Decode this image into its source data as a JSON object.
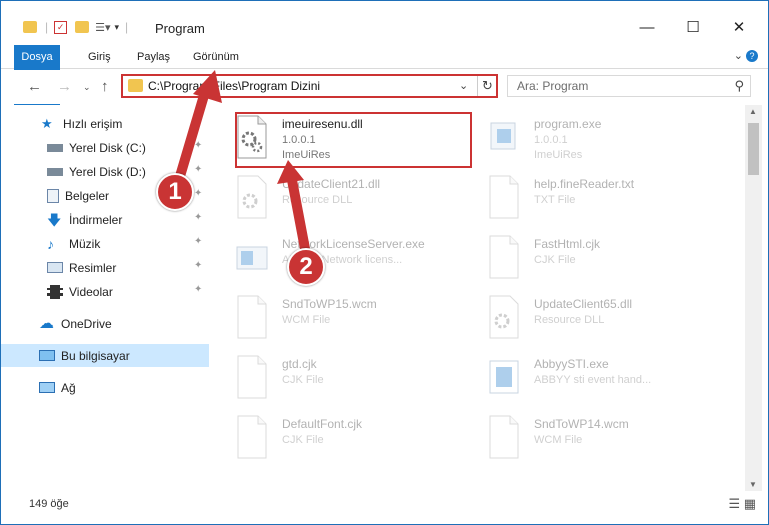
{
  "window": {
    "title": "Program"
  },
  "ribbon": {
    "tabs": [
      "Dosya",
      "Giriş",
      "Paylaş",
      "Görünüm"
    ]
  },
  "address": {
    "path": "C:\\Program Files\\Program Dizini"
  },
  "search": {
    "placeholder": "Ara: Program"
  },
  "sidebar": {
    "items": [
      {
        "label": "Hızlı erişim"
      },
      {
        "label": "Yerel Disk (C:)"
      },
      {
        "label": "Yerel Disk (D:)"
      },
      {
        "label": "Belgeler"
      },
      {
        "label": "İndirmeler"
      },
      {
        "label": "Müzik"
      },
      {
        "label": "Resimler"
      },
      {
        "label": "Videolar"
      },
      {
        "label": "OneDrive"
      },
      {
        "label": "Bu bilgisayar"
      },
      {
        "label": "Ağ"
      }
    ]
  },
  "files": [
    {
      "name": "imeuiresenu.dll",
      "line1": "1.0.0.1",
      "line2": "ImeUiRes"
    },
    {
      "name": "program.exe",
      "line1": "1.0.0.1",
      "line2": "ImeUiRes"
    },
    {
      "name": "UpdateClient21.dll",
      "line1": "Resource DLL"
    },
    {
      "name": "help.fineReader.txt",
      "line1": "TXT File"
    },
    {
      "name": "NetworkLicenseServer.exe",
      "line1": "ABBYY Network licens..."
    },
    {
      "name": "FastHtml.cjk",
      "line1": "CJK File"
    },
    {
      "name": "SndToWP15.wcm",
      "line1": "WCM File"
    },
    {
      "name": "UpdateClient65.dll",
      "line1": "Resource DLL"
    },
    {
      "name": "gtd.cjk",
      "line1": "CJK File"
    },
    {
      "name": "AbbyySTI.exe",
      "line1": "ABBYY sti event hand..."
    },
    {
      "name": "DefaultFont.cjk",
      "line1": "CJK File"
    },
    {
      "name": "SndToWP14.wcm",
      "line1": "WCM File"
    }
  ],
  "status": {
    "count": "149 öğe"
  },
  "callouts": {
    "one": "1",
    "two": "2"
  },
  "colors": {
    "accent": "#1979ca",
    "highlight": "#cc3333",
    "selected": "#cce8ff"
  }
}
